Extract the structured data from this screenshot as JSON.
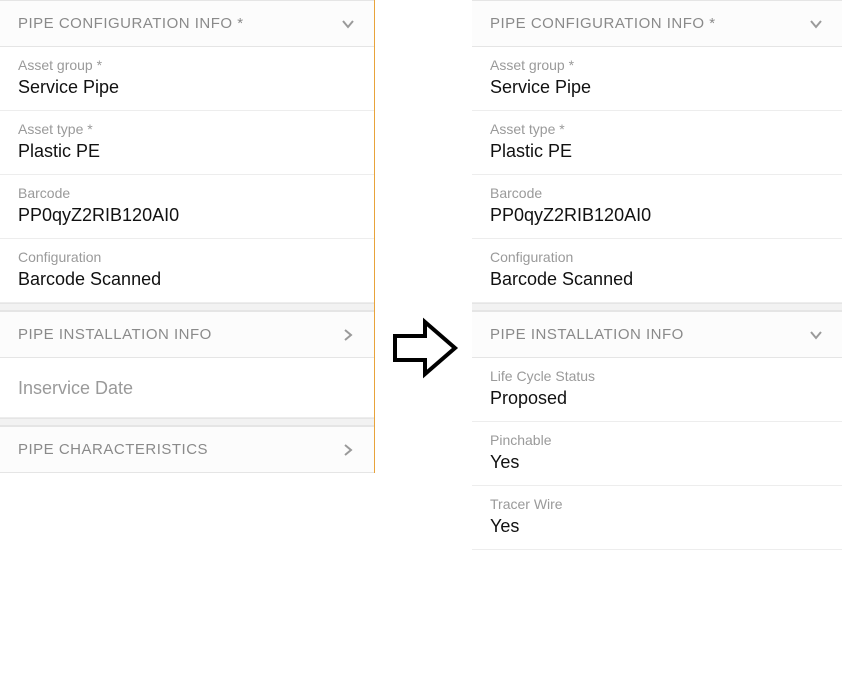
{
  "left": {
    "config_header": "PIPE CONFIGURATION INFO *",
    "asset_group_label": "Asset group *",
    "asset_group_value": "Service Pipe",
    "asset_type_label": "Asset type *",
    "asset_type_value": "Plastic PE",
    "barcode_label": "Barcode",
    "barcode_value": "PP0qyZ2RIB120AI0",
    "configuration_label": "Configuration",
    "configuration_value": "Barcode Scanned",
    "install_header": "PIPE INSTALLATION INFO",
    "inservice_label": "Inservice Date",
    "characteristics_header": "PIPE CHARACTERISTICS"
  },
  "right": {
    "config_header": "PIPE CONFIGURATION INFO *",
    "asset_group_label": "Asset group *",
    "asset_group_value": "Service Pipe",
    "asset_type_label": "Asset type *",
    "asset_type_value": "Plastic PE",
    "barcode_label": "Barcode",
    "barcode_value": "PP0qyZ2RIB120AI0",
    "configuration_label": "Configuration",
    "configuration_value": "Barcode Scanned",
    "install_header": "PIPE INSTALLATION INFO",
    "life_cycle_label": "Life Cycle Status",
    "life_cycle_value": "Proposed",
    "pinchable_label": "Pinchable",
    "pinchable_value": "Yes",
    "tracer_label": "Tracer Wire",
    "tracer_value": "Yes"
  }
}
